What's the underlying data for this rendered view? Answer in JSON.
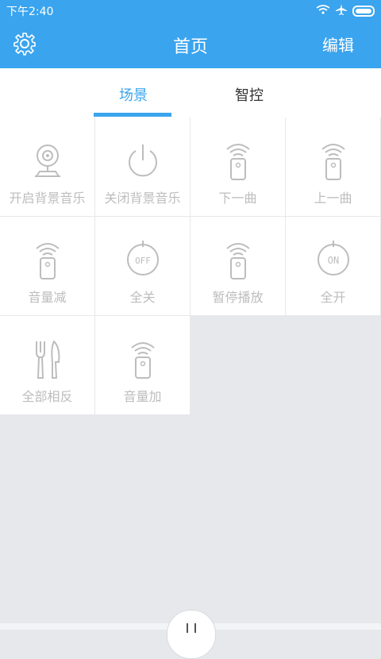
{
  "status": {
    "time": "下午2:40"
  },
  "header": {
    "title": "首页",
    "edit_label": "编辑"
  },
  "tabs": [
    {
      "label": "场景",
      "active": true
    },
    {
      "label": "智控",
      "active": false
    }
  ],
  "scenes": [
    {
      "label": "开启背景音乐",
      "icon": "camera-icon"
    },
    {
      "label": "关闭背景音乐",
      "icon": "power-icon"
    },
    {
      "label": "下一曲",
      "icon": "remote-icon"
    },
    {
      "label": "上一曲",
      "icon": "remote-icon"
    },
    {
      "label": "音量减",
      "icon": "remote-icon"
    },
    {
      "label": "全关",
      "icon": "off-icon",
      "badge": "OFF"
    },
    {
      "label": "暂停播放",
      "icon": "remote-icon"
    },
    {
      "label": "全开",
      "icon": "on-icon",
      "badge": "ON"
    },
    {
      "label": "全部相反",
      "icon": "fork-knife-icon"
    },
    {
      "label": "音量加",
      "icon": "remote-icon"
    }
  ],
  "colors": {
    "accent": "#3aa4ee",
    "label": "#bdbdbd",
    "bg": "#e6e8eb"
  }
}
